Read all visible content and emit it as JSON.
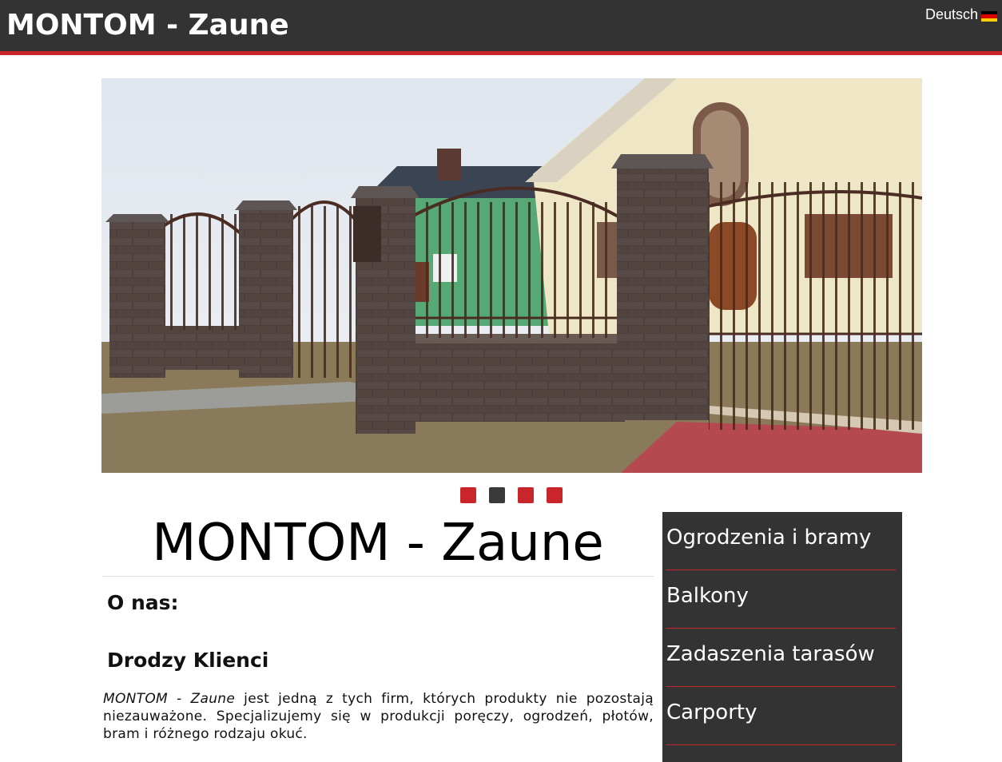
{
  "header": {
    "site_title": "MONTOM - Zaune",
    "language_label": "Deutsch",
    "language_flag_icon": "flag-de-icon"
  },
  "slider": {
    "image_alt": "Ogrodzenie z cegły i kutej bramy przed domem",
    "dots": [
      {
        "active": false,
        "color": "#c8262b"
      },
      {
        "active": true,
        "color": "#3a3a3a"
      },
      {
        "active": false,
        "color": "#c8262b"
      },
      {
        "active": false,
        "color": "#c8262b"
      }
    ]
  },
  "main": {
    "title": "MONTOM - Zaune",
    "heading_about": "O nas:",
    "heading_clients": "Drodzy Klienci",
    "paragraph_lead": "MONTOM - Zaune",
    "paragraph_rest": " jest jedną z tych firm, których produkty nie pozostają niezauważone. Specjalizujemy się w produkcji poręczy, ogrodzeń, płotów, bram i różnego rodzaju okuć."
  },
  "sidebar": {
    "items": [
      {
        "label": "Ogrodzenia i bramy"
      },
      {
        "label": "Balkony"
      },
      {
        "label": "Zadaszenia tarasów"
      },
      {
        "label": "Carporty"
      }
    ]
  },
  "colors": {
    "header_bg": "#333333",
    "accent": "#c8262b",
    "sidebar_bg": "#333333"
  }
}
